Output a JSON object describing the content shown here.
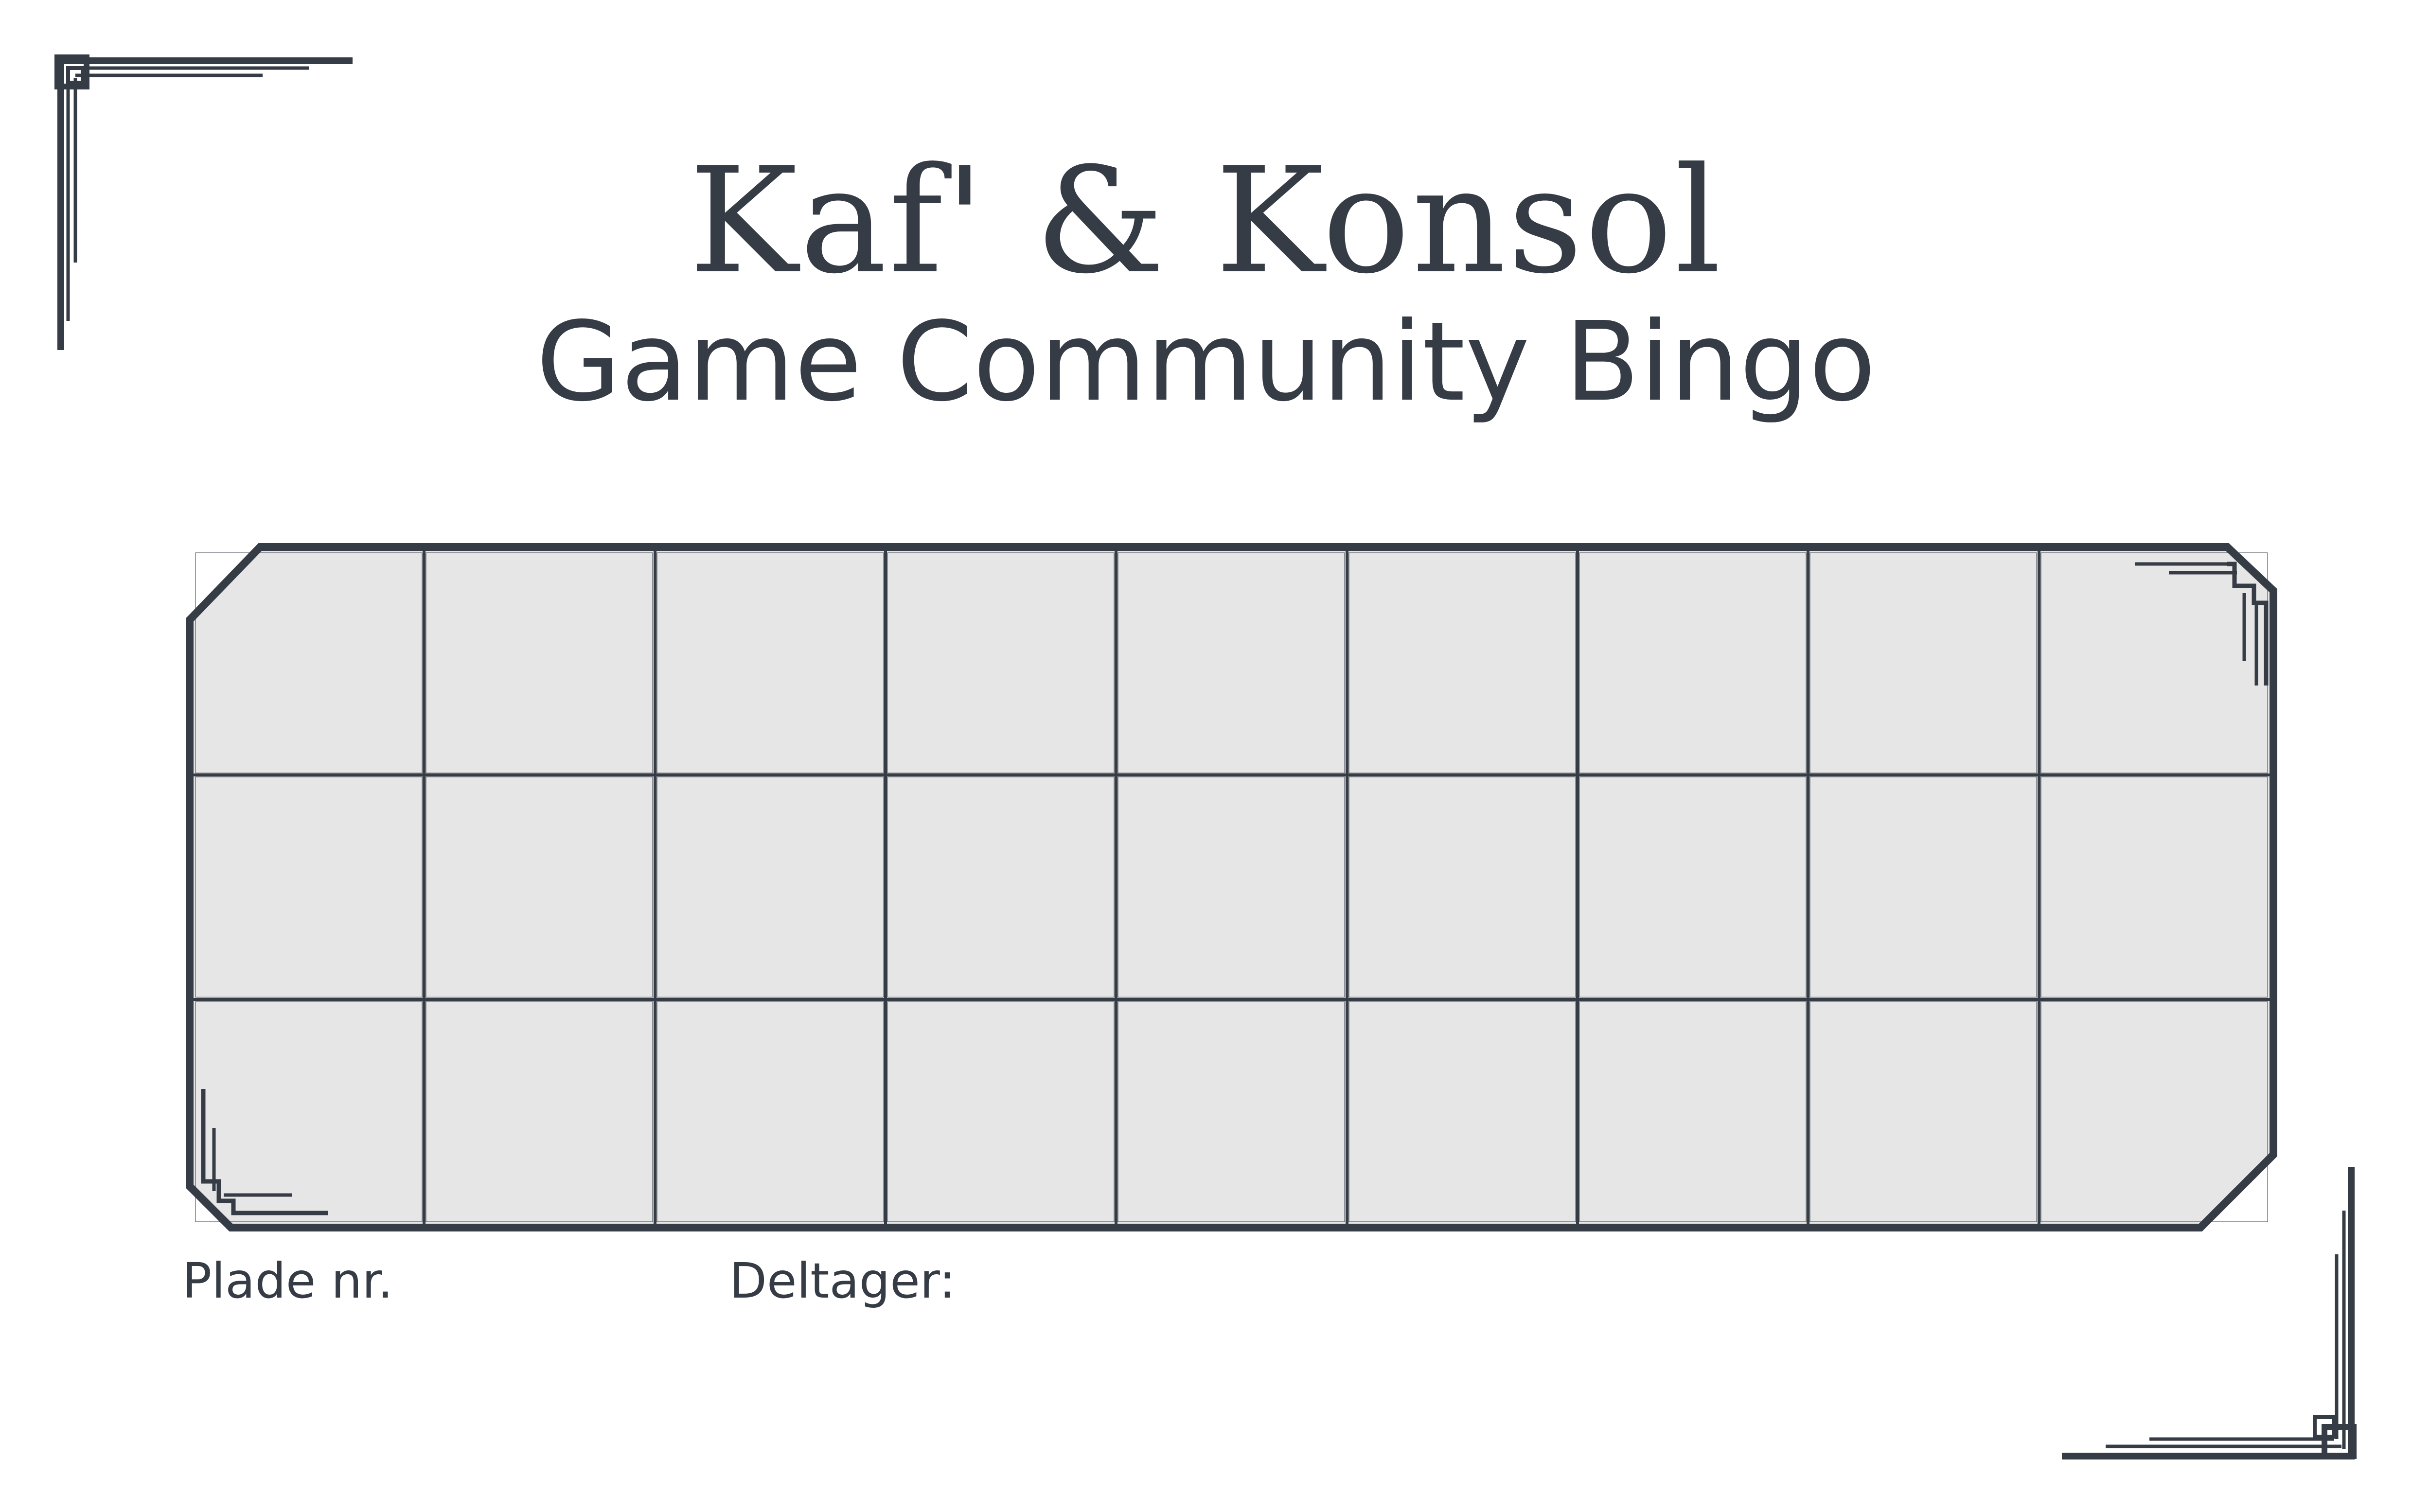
{
  "header": {
    "logo_text": "Kaf' & Konsol",
    "title": "Game Community Bingo"
  },
  "card": {
    "rows": 3,
    "columns": 9,
    "cell_fill": "#e6e6e6"
  },
  "footer": {
    "plade_label": "Plade nr.",
    "deltager_label": "Deltager:"
  },
  "colors": {
    "ink": "#363c45",
    "background": "#ffffff"
  }
}
